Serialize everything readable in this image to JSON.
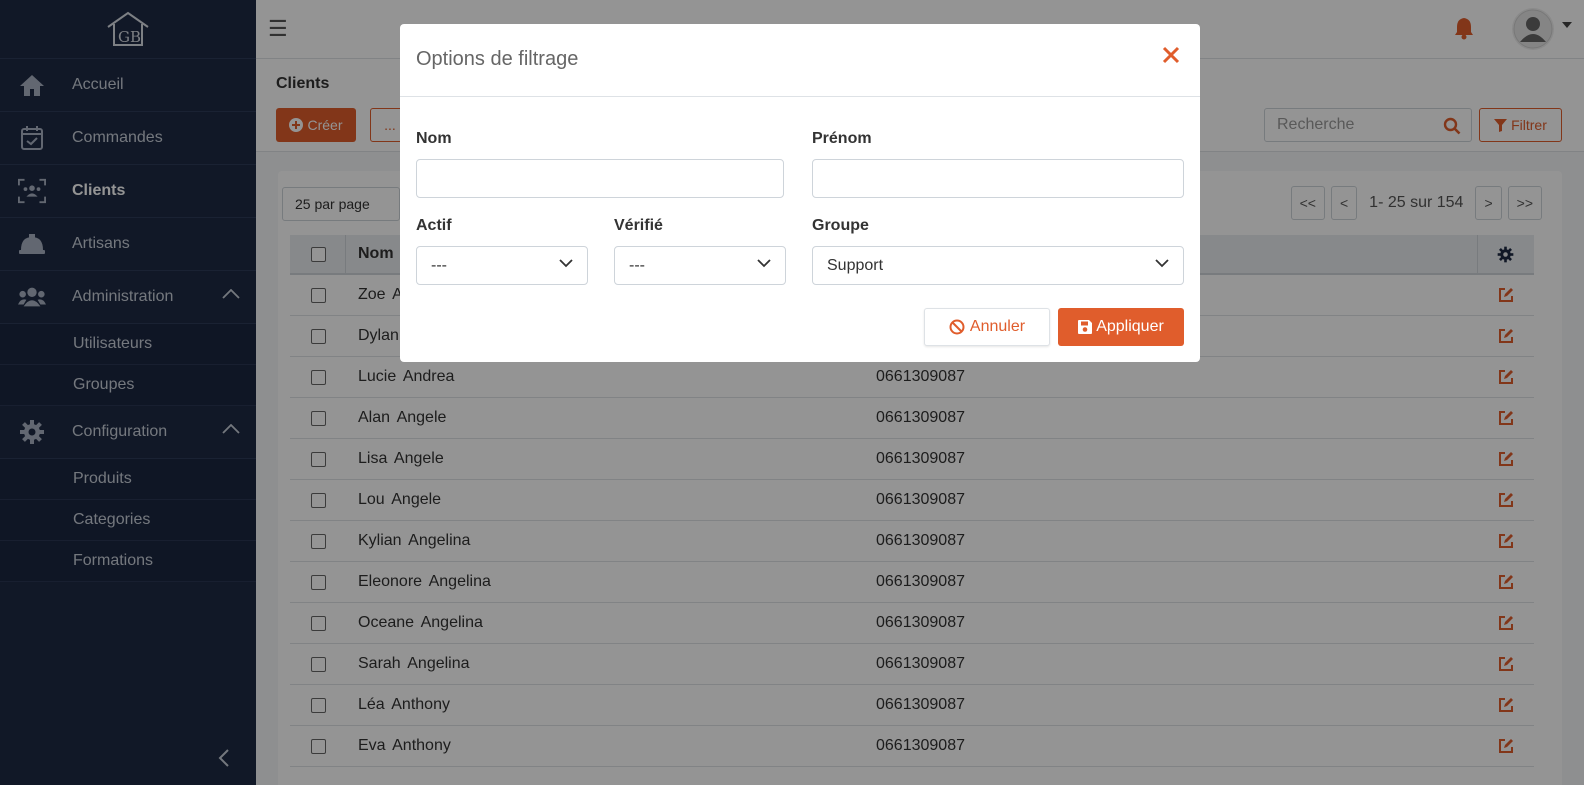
{
  "sidebar": {
    "items": [
      {
        "label": "Accueil",
        "icon": "home-icon"
      },
      {
        "label": "Commandes",
        "icon": "calendar-check-icon"
      },
      {
        "label": "Clients",
        "icon": "users-frame-icon"
      },
      {
        "label": "Artisans",
        "icon": "hard-hat-icon"
      },
      {
        "label": "Administration",
        "icon": "users-icon"
      },
      {
        "label": "Configuration",
        "icon": "gear-icon"
      }
    ],
    "admin_sub": [
      "Utilisateurs",
      "Groupes"
    ],
    "config_sub": [
      "Produits",
      "Categories",
      "Formations"
    ]
  },
  "header": {
    "breadcrumb": "Clients",
    "create_label": "Créer",
    "more_label": "...",
    "search_placeholder": "Recherche",
    "filter_label": "Filtrer"
  },
  "table": {
    "per_page": "25 par page",
    "pagination": {
      "first": "<<",
      "prev": "<",
      "info": "1- 25 sur 154",
      "next": ">",
      "last": ">>"
    },
    "columns": [
      "Nom"
    ],
    "rows": [
      {
        "name": "Zoe  A",
        "phone": ""
      },
      {
        "name": "Dylan",
        "phone": ""
      },
      {
        "name": "Lucie  Andrea",
        "phone": "0661309087"
      },
      {
        "name": "Alan  Angele",
        "phone": "0661309087"
      },
      {
        "name": "Lisa  Angele",
        "phone": "0661309087"
      },
      {
        "name": "Lou  Angele",
        "phone": "0661309087"
      },
      {
        "name": "Kylian  Angelina",
        "phone": "0661309087"
      },
      {
        "name": "Eleonore  Angelina",
        "phone": "0661309087"
      },
      {
        "name": "Oceane  Angelina",
        "phone": "0661309087"
      },
      {
        "name": "Sarah  Angelina",
        "phone": "0661309087"
      },
      {
        "name": "Léa  Anthony",
        "phone": "0661309087"
      },
      {
        "name": "Eva  Anthony",
        "phone": "0661309087"
      }
    ]
  },
  "modal": {
    "title": "Options de filtrage",
    "nom_label": "Nom",
    "nom_value": "",
    "prenom_label": "Prénom",
    "prenom_value": "",
    "actif_label": "Actif",
    "actif_value": "---",
    "verifie_label": "Vérifié",
    "verifie_value": "---",
    "groupe_label": "Groupe",
    "groupe_value": "Support",
    "cancel_label": "Annuler",
    "apply_label": "Appliquer"
  },
  "colors": {
    "accent": "#e05d2c",
    "sidebar": "#1e2a44"
  }
}
